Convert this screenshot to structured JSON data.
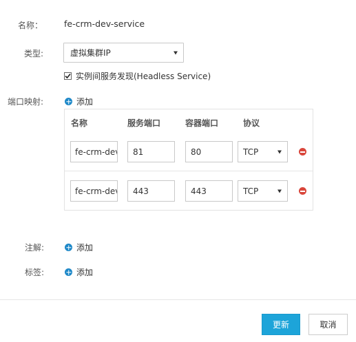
{
  "form": {
    "name_label": "名称：",
    "name_value": "fe-crm-dev-service",
    "type_label": "类型:",
    "type_selected": "虚拟集群IP",
    "headless_checked": true,
    "headless_label": "实例间服务发现(Headless Service)",
    "port_mapping_label": "端口映射:",
    "add_label": "添加",
    "annotation_label": "注解:",
    "tag_label": "标签:"
  },
  "port_table": {
    "headers": [
      "名称",
      "服务端口",
      "容器端口",
      "协议"
    ],
    "rows": [
      {
        "name": "fe-crm-dev",
        "service_port": "81",
        "container_port": "80",
        "protocol": "TCP"
      },
      {
        "name": "fe-crm-dev",
        "service_port": "443",
        "container_port": "443",
        "protocol": "TCP"
      }
    ]
  },
  "footer": {
    "update_label": "更新",
    "cancel_label": "取消"
  },
  "colors": {
    "accent": "#1da4d9",
    "plus_icon": "#1e88c8",
    "remove_icon": "#d9463b"
  }
}
